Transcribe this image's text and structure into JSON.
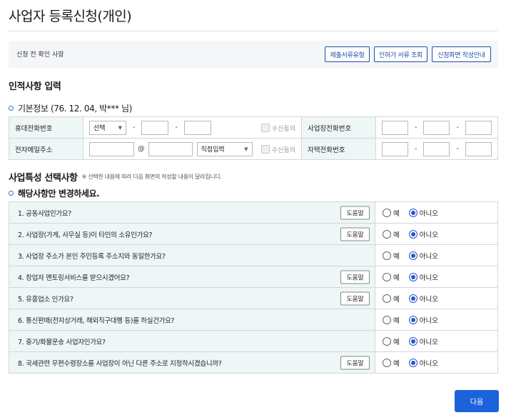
{
  "page": {
    "title": "사업자 등록신청(개인)"
  },
  "pre_check": {
    "label": "신청 전 확인 사항",
    "buttons": [
      "제출서류유형",
      "인허가 서류 조회",
      "신청화면 작성안내"
    ]
  },
  "personal": {
    "heading": "인적사항 입력",
    "basic_info": "기본정보 (76. 12. 04, 박*** 님)",
    "rows": {
      "mobile_label": "휴대전화번호",
      "mobile_select": "선택",
      "receive_label": "수신동의",
      "biz_phone_label": "사업장전화번호",
      "email_label": "전자메일주소",
      "email_at": "@",
      "email_domain_select": "직접입력",
      "home_phone_label": "자택전화번호",
      "dash": "-"
    }
  },
  "features": {
    "heading": "사업특성 선택사항",
    "note": "※ 선택한 내용에 따라 다음 화면의 작성할 내용이 달라집니다.",
    "subheading": "해당사항만 변경하세요.",
    "help_label": "도움말",
    "yes_label": "예",
    "no_label": "아니오",
    "questions": [
      {
        "text": "1. 공동사업인가요?",
        "help": true,
        "answer": "no"
      },
      {
        "text": "2. 사업장(가게, 사무실 등)이 타인의 소유인가요?",
        "help": true,
        "answer": "no"
      },
      {
        "text": "3. 사업장 주소가 본인 주민등록 주소지와 동일한가요?",
        "help": false,
        "answer": "no"
      },
      {
        "text": "4. 창업자 멘토링서비스를 받으시겠어요?",
        "help": true,
        "answer": "no"
      },
      {
        "text": "5. 유흥업소 인가요?",
        "help": true,
        "answer": "no"
      },
      {
        "text": "6. 통신판매(전자상거래, 해외직구대행 등)를 하실건가요?",
        "help": false,
        "answer": "no"
      },
      {
        "text": "7. 중기/화물운송 사업자인가요?",
        "help": false,
        "answer": "no"
      },
      {
        "text": "8. 국세관련 우편수령장소를 사업장이 아닌 다른 주소로 지정하시겠습니까?",
        "help": true,
        "answer": "no"
      }
    ]
  },
  "footer": {
    "next_label": "다음"
  },
  "colors": {
    "accent": "#1b63db",
    "label_bg": "#eef6f6",
    "prebox_bg": "#f4f6f9"
  }
}
